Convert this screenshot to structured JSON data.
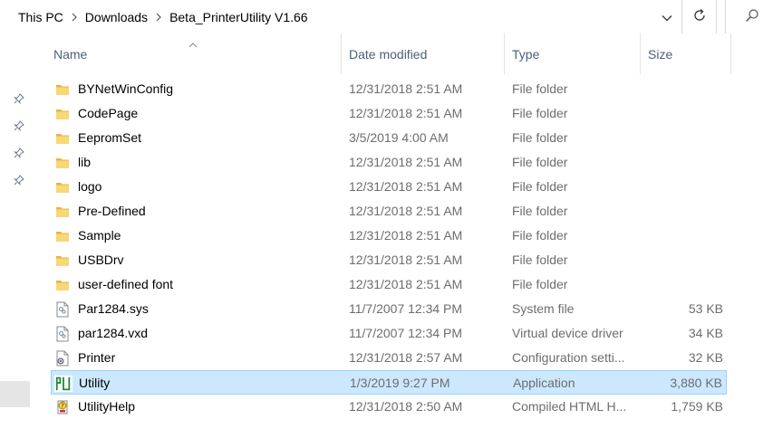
{
  "breadcrumbs": [
    "This PC",
    "Downloads",
    "Beta_PrinterUtility V1.66"
  ],
  "toolbar": {
    "history_icon": "chevron-down-icon",
    "refresh_icon": "refresh-icon",
    "search_icon": "search-icon"
  },
  "columns": {
    "name": "Name",
    "date": "Date modified",
    "type": "Type",
    "size": "Size"
  },
  "colors": {
    "selection_bg": "#cce8ff",
    "selection_border": "#99d1ff",
    "folder": "#e8b53a",
    "header_text": "#4c607a"
  },
  "files": [
    {
      "name": "BYNetWinConfig",
      "date": "12/31/2018 2:51 AM",
      "type": "File folder",
      "size": "",
      "icon": "folder-icon"
    },
    {
      "name": "CodePage",
      "date": "12/31/2018 2:51 AM",
      "type": "File folder",
      "size": "",
      "icon": "folder-icon"
    },
    {
      "name": "EepromSet",
      "date": "3/5/2019 4:00 AM",
      "type": "File folder",
      "size": "",
      "icon": "folder-icon"
    },
    {
      "name": "lib",
      "date": "12/31/2018 2:51 AM",
      "type": "File folder",
      "size": "",
      "icon": "folder-icon"
    },
    {
      "name": "logo",
      "date": "12/31/2018 2:51 AM",
      "type": "File folder",
      "size": "",
      "icon": "folder-icon"
    },
    {
      "name": "Pre-Defined",
      "date": "12/31/2018 2:51 AM",
      "type": "File folder",
      "size": "",
      "icon": "folder-icon"
    },
    {
      "name": "Sample",
      "date": "12/31/2018 2:51 AM",
      "type": "File folder",
      "size": "",
      "icon": "folder-icon"
    },
    {
      "name": "USBDrv",
      "date": "12/31/2018 2:51 AM",
      "type": "File folder",
      "size": "",
      "icon": "folder-icon"
    },
    {
      "name": "user-defined font",
      "date": "12/31/2018 2:51 AM",
      "type": "File folder",
      "size": "",
      "icon": "folder-icon"
    },
    {
      "name": "Par1284.sys",
      "date": "11/7/2007 12:34 PM",
      "type": "System file",
      "size": "53 KB",
      "icon": "system-file-icon"
    },
    {
      "name": "par1284.vxd",
      "date": "11/7/2007 12:34 PM",
      "type": "Virtual device driver",
      "size": "34 KB",
      "icon": "system-file-icon"
    },
    {
      "name": "Printer",
      "date": "12/31/2018 2:57 AM",
      "type": "Configuration setti...",
      "size": "32 KB",
      "icon": "config-file-icon"
    },
    {
      "name": "Utility",
      "date": "1/3/2019 9:27 PM",
      "type": "Application",
      "size": "3,880 KB",
      "icon": "app-icon",
      "selected": true
    },
    {
      "name": "UtilityHelp",
      "date": "12/31/2018 2:50 AM",
      "type": "Compiled HTML H...",
      "size": "1,759 KB",
      "icon": "help-file-icon"
    }
  ]
}
